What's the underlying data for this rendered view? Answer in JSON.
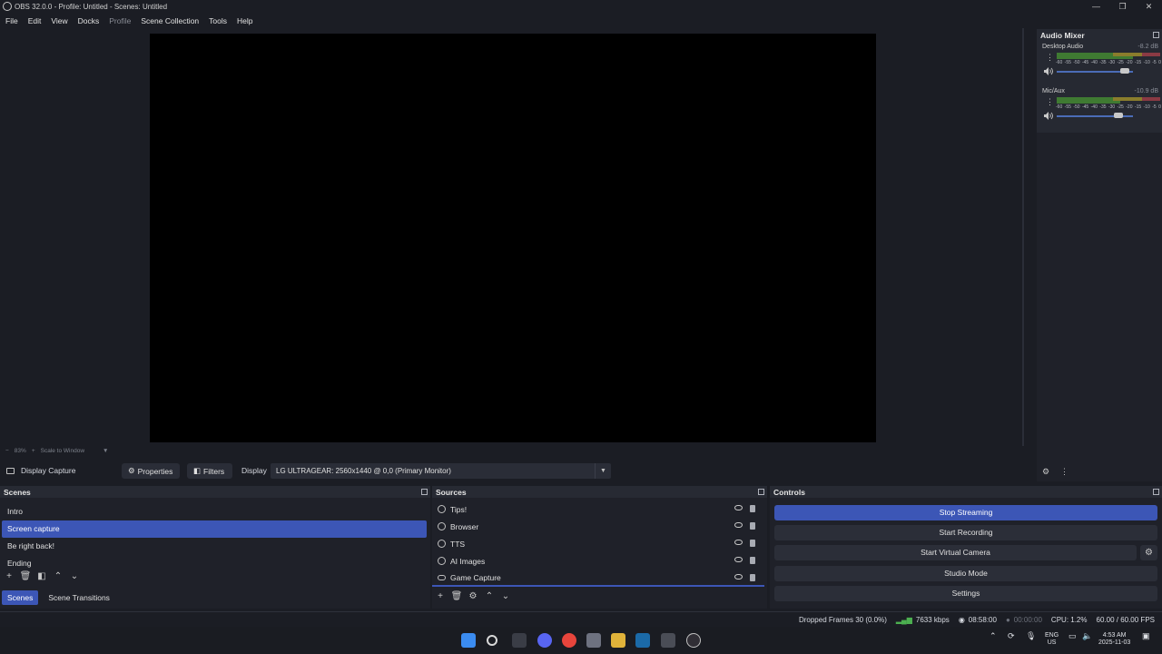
{
  "window": {
    "title": "OBS 32.0.0 - Profile: Untitled - Scenes: Untitled",
    "controls": [
      "—",
      "❐",
      "✕"
    ]
  },
  "menu": [
    {
      "label": "File",
      "enabled": true
    },
    {
      "label": "Edit",
      "enabled": true
    },
    {
      "label": "View",
      "enabled": true
    },
    {
      "label": "Docks",
      "enabled": true
    },
    {
      "label": "Profile",
      "enabled": false
    },
    {
      "label": "Scene Collection",
      "enabled": true
    },
    {
      "label": "Tools",
      "enabled": true
    },
    {
      "label": "Help",
      "enabled": true
    }
  ],
  "zoombar": {
    "minus": "−",
    "zoom": "83%",
    "plus": "+",
    "mode": "Scale to Window",
    "arrow": "▼"
  },
  "context": {
    "source_name": "Display Capture",
    "properties_label": "Properties",
    "filters_label": "Filters",
    "display_label": "Display",
    "display_value": "LG ULTRAGEAR: 2560x1440 @ 0,0 (Primary Monitor)"
  },
  "audio_mixer": {
    "title": "Audio Mixer",
    "ticks": [
      "-60",
      "-55",
      "-50",
      "-45",
      "-40",
      "-35",
      "-30",
      "-25",
      "-20",
      "-15",
      "-10",
      "-5",
      "0"
    ],
    "channels": [
      {
        "name": "Desktop Audio",
        "db": "-8.2 dB",
        "volume": 0.9
      },
      {
        "name": "Mic/Aux",
        "db": "-10.9 dB",
        "volume": 0.83
      }
    ]
  },
  "scenes": {
    "title": "Scenes",
    "items": [
      {
        "label": "Intro",
        "selected": false
      },
      {
        "label": "Screen capture",
        "selected": true
      },
      {
        "label": "Be right back!",
        "selected": false
      },
      {
        "label": "Ending",
        "selected": false
      }
    ]
  },
  "sources": {
    "title": "Sources",
    "items": [
      {
        "label": "Tips!"
      },
      {
        "label": "Browser"
      },
      {
        "label": "TTS"
      },
      {
        "label": "AI Images"
      },
      {
        "label": "Game Capture"
      }
    ]
  },
  "controls": {
    "title": "Controls",
    "stop_streaming": "Stop Streaming",
    "start_recording": "Start Recording",
    "start_virtual_camera": "Start Virtual Camera",
    "studio_mode": "Studio Mode",
    "settings": "Settings"
  },
  "tabs": {
    "scenes": "Scenes",
    "transitions": "Scene Transitions"
  },
  "status": {
    "dropped_frames": "Dropped Frames 30 (0.0%)",
    "bitrate": "7633 kbps",
    "stream_time": "08:58:00",
    "record_time": "00:00:00",
    "cpu": "CPU: 1.2%",
    "fps": "60.00 / 60.00 FPS"
  },
  "tray": {
    "lang1": "ENG",
    "lang2": "US",
    "time": "4:53 AM",
    "date": "2025-11-03"
  },
  "colors": {
    "accent": "#3c56b6",
    "background": "#1b1d24",
    "panel": "#1f2129"
  }
}
